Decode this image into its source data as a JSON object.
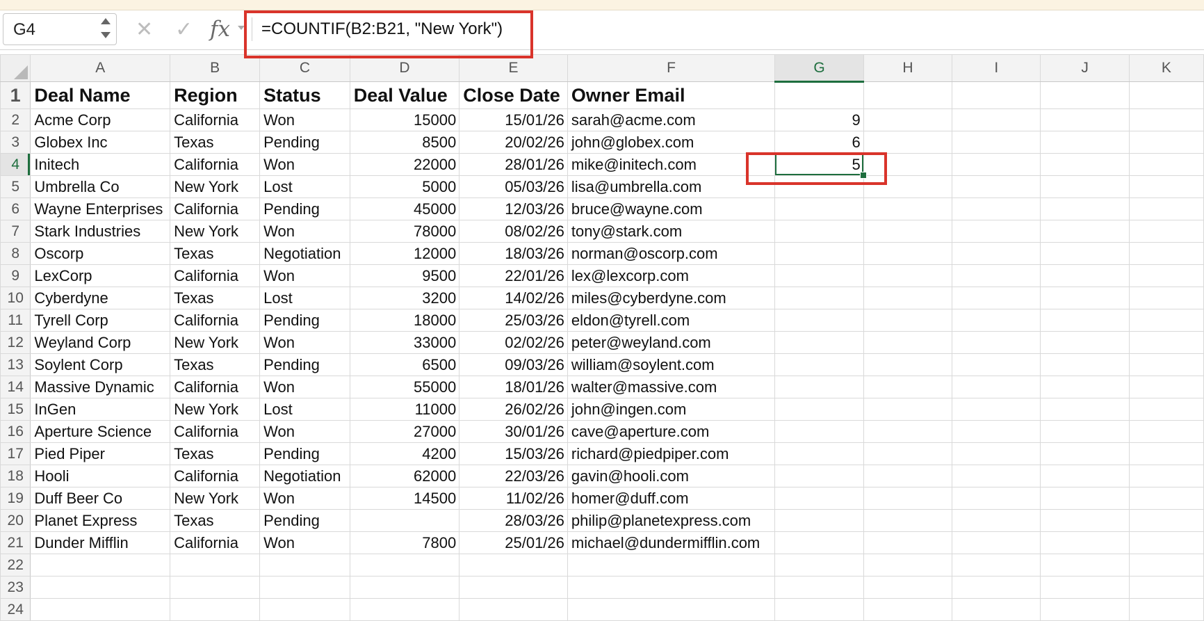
{
  "name_box": "G4",
  "formula": "=COUNTIF(B2:B21, \"New York\")",
  "icons": {
    "cancel": "✕",
    "enter": "✓",
    "fx": "fx"
  },
  "columns": [
    "A",
    "B",
    "C",
    "D",
    "E",
    "F",
    "G",
    "H",
    "I",
    "J",
    "K"
  ],
  "selected_column": "G",
  "selected_row": 4,
  "row_numbers": [
    "1",
    "2",
    "3",
    "4",
    "5",
    "6",
    "7",
    "8",
    "9",
    "10",
    "11",
    "12",
    "13",
    "14",
    "15",
    "16",
    "17",
    "18",
    "19",
    "20",
    "21",
    "22",
    "23",
    "24"
  ],
  "header": {
    "a": "Deal Name",
    "b": "Region",
    "c": "Status",
    "d": "Deal Value",
    "e": "Close Date",
    "f": "Owner Email",
    "g": ""
  },
  "rows": [
    {
      "a": "Acme Corp",
      "b": "California",
      "c": "Won",
      "d": "15000",
      "e": "15/01/26",
      "f": "sarah@acme.com",
      "g": "9"
    },
    {
      "a": "Globex Inc",
      "b": "Texas",
      "c": "Pending",
      "d": "8500",
      "e": "20/02/26",
      "f": "john@globex.com",
      "g": "6"
    },
    {
      "a": "Initech",
      "b": "California",
      "c": "Won",
      "d": "22000",
      "e": "28/01/26",
      "f": "mike@initech.com",
      "g": "5"
    },
    {
      "a": "Umbrella Co",
      "b": "New York",
      "c": "Lost",
      "d": "5000",
      "e": "05/03/26",
      "f": "lisa@umbrella.com",
      "g": ""
    },
    {
      "a": "Wayne Enterprises",
      "b": "California",
      "c": "Pending",
      "d": "45000",
      "e": "12/03/26",
      "f": "bruce@wayne.com",
      "g": ""
    },
    {
      "a": "Stark Industries",
      "b": "New York",
      "c": "Won",
      "d": "78000",
      "e": "08/02/26",
      "f": "tony@stark.com",
      "g": ""
    },
    {
      "a": "Oscorp",
      "b": "Texas",
      "c": "Negotiation",
      "d": "12000",
      "e": "18/03/26",
      "f": "norman@oscorp.com",
      "g": ""
    },
    {
      "a": "LexCorp",
      "b": "California",
      "c": "Won",
      "d": "9500",
      "e": "22/01/26",
      "f": "lex@lexcorp.com",
      "g": ""
    },
    {
      "a": "Cyberdyne",
      "b": "Texas",
      "c": "Lost",
      "d": "3200",
      "e": "14/02/26",
      "f": "miles@cyberdyne.com",
      "g": ""
    },
    {
      "a": "Tyrell Corp",
      "b": "California",
      "c": "Pending",
      "d": "18000",
      "e": "25/03/26",
      "f": "eldon@tyrell.com",
      "g": ""
    },
    {
      "a": "Weyland Corp",
      "b": "New York",
      "c": "Won",
      "d": "33000",
      "e": "02/02/26",
      "f": "peter@weyland.com",
      "g": ""
    },
    {
      "a": "Soylent Corp",
      "b": "Texas",
      "c": "Pending",
      "d": "6500",
      "e": "09/03/26",
      "f": "william@soylent.com",
      "g": ""
    },
    {
      "a": "Massive Dynamic",
      "b": "California",
      "c": "Won",
      "d": "55000",
      "e": "18/01/26",
      "f": "walter@massive.com",
      "g": ""
    },
    {
      "a": "InGen",
      "b": "New York",
      "c": "Lost",
      "d": "11000",
      "e": "26/02/26",
      "f": "john@ingen.com",
      "g": ""
    },
    {
      "a": "Aperture Science",
      "b": "California",
      "c": "Won",
      "d": "27000",
      "e": "30/01/26",
      "f": "cave@aperture.com",
      "g": ""
    },
    {
      "a": "Pied Piper",
      "b": "Texas",
      "c": "Pending",
      "d": "4200",
      "e": "15/03/26",
      "f": "richard@piedpiper.com",
      "g": ""
    },
    {
      "a": "Hooli",
      "b": "California",
      "c": "Negotiation",
      "d": "62000",
      "e": "22/03/26",
      "f": "gavin@hooli.com",
      "g": ""
    },
    {
      "a": "Duff Beer Co",
      "b": "New York",
      "c": "Won",
      "d": "14500",
      "e": "11/02/26",
      "f": "homer@duff.com",
      "g": ""
    },
    {
      "a": "Planet Express",
      "b": "Texas",
      "c": "Pending",
      "d": "",
      "e": "28/03/26",
      "f": "philip@planetexpress.com",
      "g": ""
    },
    {
      "a": "Dunder Mifflin",
      "b": "California",
      "c": "Won",
      "d": "7800",
      "e": "25/01/26",
      "f": "michael@dundermifflin.com",
      "g": ""
    }
  ],
  "colors": {
    "highlight": "#d9342b",
    "selection": "#1e6e3e"
  }
}
